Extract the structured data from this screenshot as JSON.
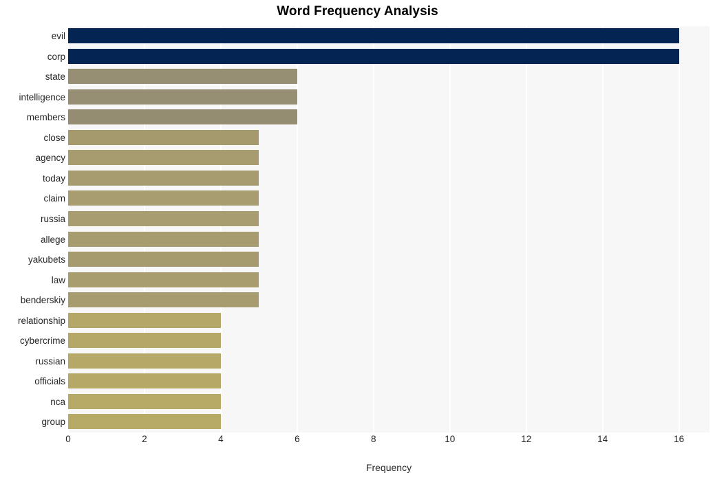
{
  "chart_data": {
    "type": "bar",
    "orientation": "horizontal",
    "title": "Word Frequency Analysis",
    "xlabel": "Frequency",
    "ylabel": "",
    "xlim": [
      0,
      16.8
    ],
    "xticks": [
      0,
      2,
      4,
      6,
      8,
      10,
      12,
      14,
      16
    ],
    "xtick_labels": [
      "0",
      "2",
      "4",
      "6",
      "8",
      "10",
      "12",
      "14",
      "16"
    ],
    "grid": true,
    "grid_axis": "x",
    "legend": null,
    "categories": [
      "evil",
      "corp",
      "state",
      "intelligence",
      "members",
      "close",
      "agency",
      "today",
      "claim",
      "russia",
      "allege",
      "yakubets",
      "law",
      "benderskiy",
      "relationship",
      "cybercrime",
      "russian",
      "officials",
      "nca",
      "group"
    ],
    "values": [
      16,
      16,
      6,
      6,
      6,
      5,
      5,
      5,
      5,
      5,
      5,
      5,
      5,
      5,
      4,
      4,
      4,
      4,
      4,
      4
    ],
    "bar_colors": [
      "#042553",
      "#042553",
      "#978F74",
      "#978F74",
      "#958D72",
      "#A59A6E",
      "#A79C70",
      "#A79C70",
      "#A89D70",
      "#A89D70",
      "#A79C70",
      "#A69B6F",
      "#A89D6F",
      "#A79C70",
      "#B5A767",
      "#B5A767",
      "#B6A866",
      "#B6A866",
      "#B7A966",
      "#B7A966"
    ],
    "plot_background": "#f7f7f7",
    "gridline_color": "#ffffff",
    "figure_background": "#ffffff"
  }
}
